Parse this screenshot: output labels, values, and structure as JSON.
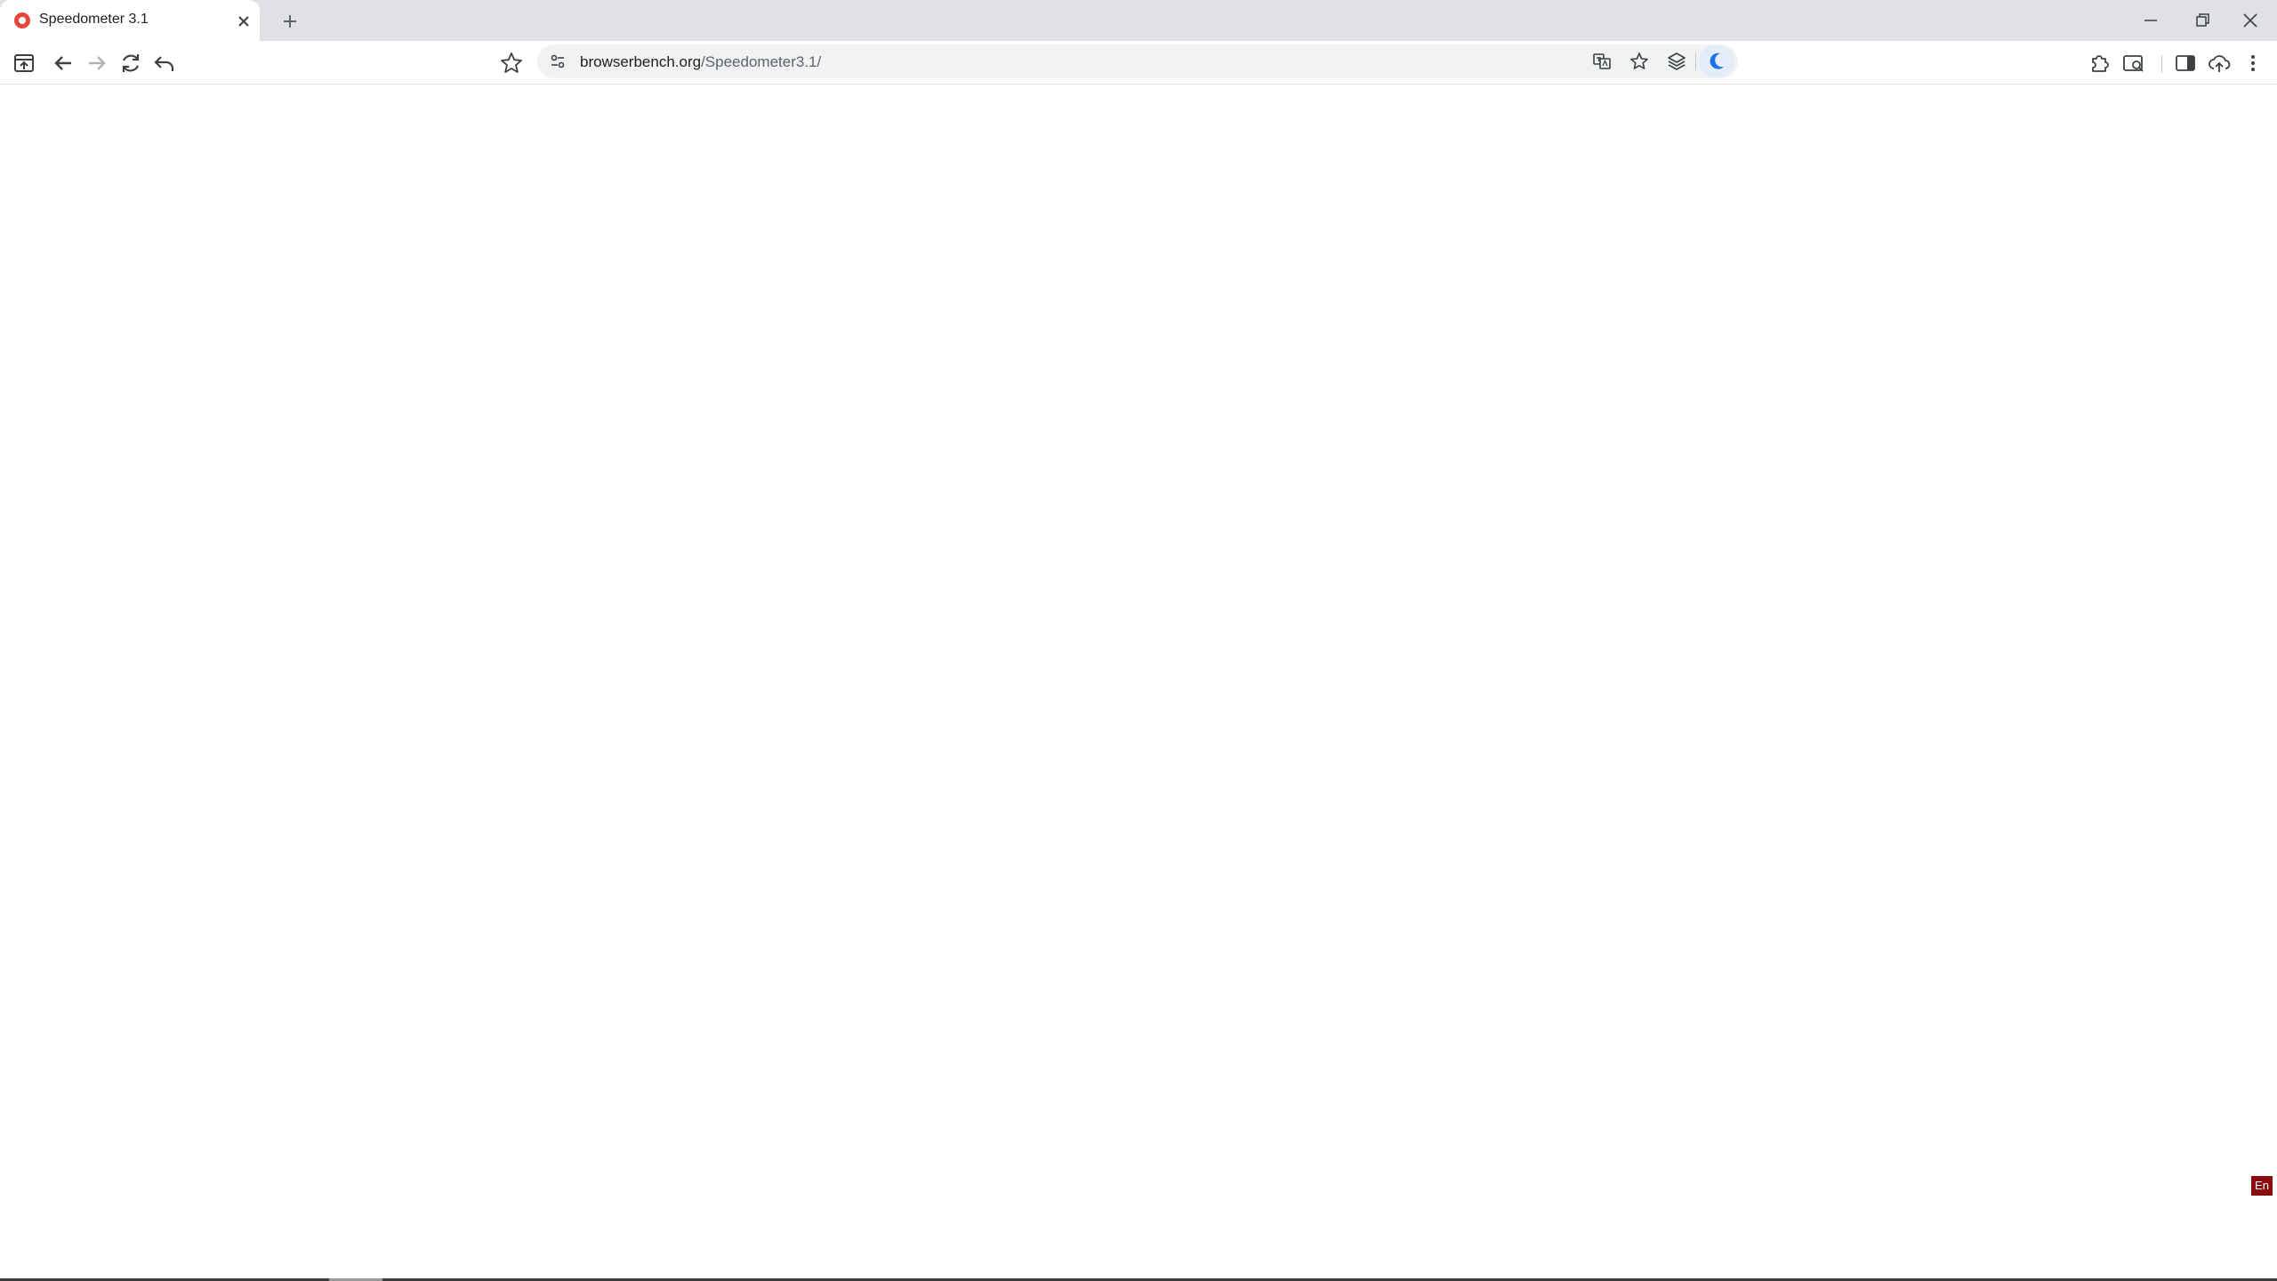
{
  "tab": {
    "title": "Speedometer 3.1",
    "favicon": "speedometer-favicon",
    "favicon_color": "#e8453c"
  },
  "omnibox": {
    "url_host": "browserbench.org",
    "url_path": "/Speedometer3.1/"
  },
  "icons": {
    "tab_close": "close-icon",
    "new_tab": "plus-icon",
    "window_minimize": "minimize-icon",
    "window_restore": "restore-icon",
    "window_close": "close-icon",
    "toolbar_left": [
      "tab-upload-icon",
      "back-arrow-icon",
      "forward-arrow-icon",
      "reload-icon",
      "undo-icon"
    ],
    "bookmark": "star-outline-icon",
    "site_info": "tune-icon",
    "omnibox_right": [
      "translate-icon",
      "star-icon",
      "layers-icon",
      "moon-icon"
    ],
    "toolbar_right": [
      "puzzle-icon",
      "search-tab-icon",
      "side-panel-icon",
      "cloud-upload-icon",
      "kebab-menu-icon"
    ]
  },
  "language_badge": {
    "label": "En",
    "color": "#8b0c0c"
  },
  "colors": {
    "tabstrip_bg": "#dfe1e5",
    "omnibox_bg": "#f0f2f4",
    "moon_accent": "#1a73e8"
  }
}
